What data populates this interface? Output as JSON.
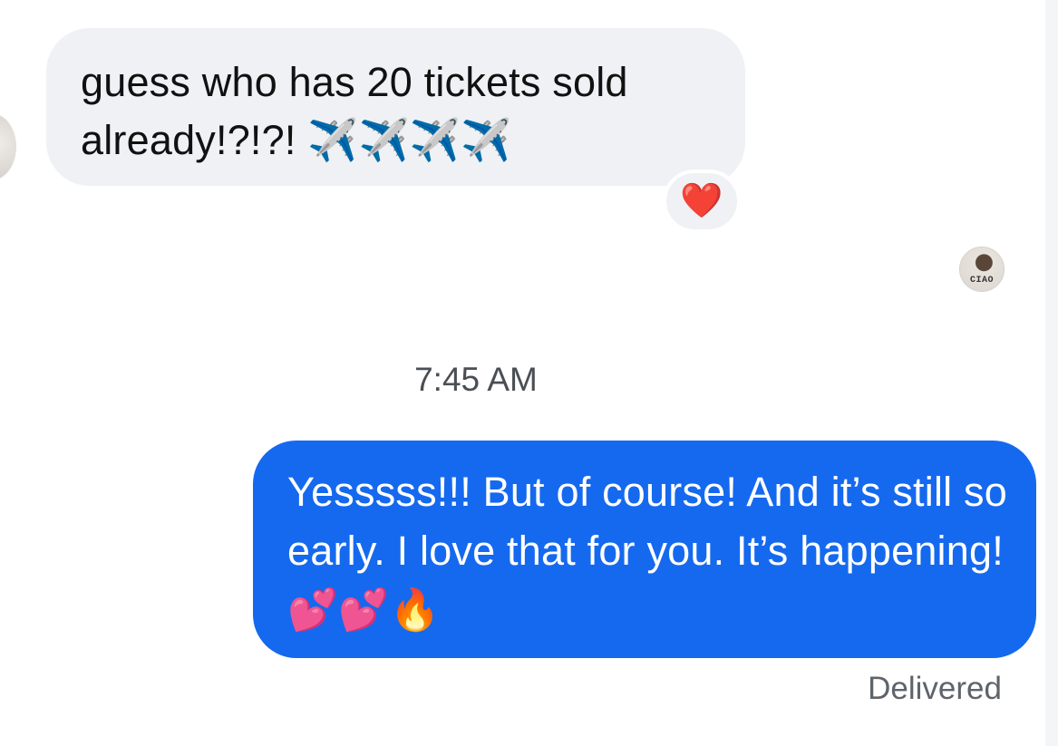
{
  "conversation": {
    "incoming_message": {
      "text": "guess who has 20 tickets sold already!?!?! ✈️✈️✈️✈️",
      "reaction": "❤️"
    },
    "seen_avatar": {
      "caption": "CIAO"
    },
    "timestamp": "7:45 AM",
    "outgoing_message": {
      "text": "Yesssss!!! But of course! And it’s still so early. I love that for you. It’s happening! 💕💕🔥",
      "status": "Delivered"
    }
  },
  "colors": {
    "incoming_bubble": "#eff1f4",
    "outgoing_bubble": "#1569ef",
    "timestamp_text": "#4a4f55",
    "status_text": "#5e646b"
  },
  "icons": {
    "reaction": "heart-reaction-icon",
    "sender_avatar": "sender-avatar",
    "read_receipt_avatar": "read-receipt-avatar"
  }
}
